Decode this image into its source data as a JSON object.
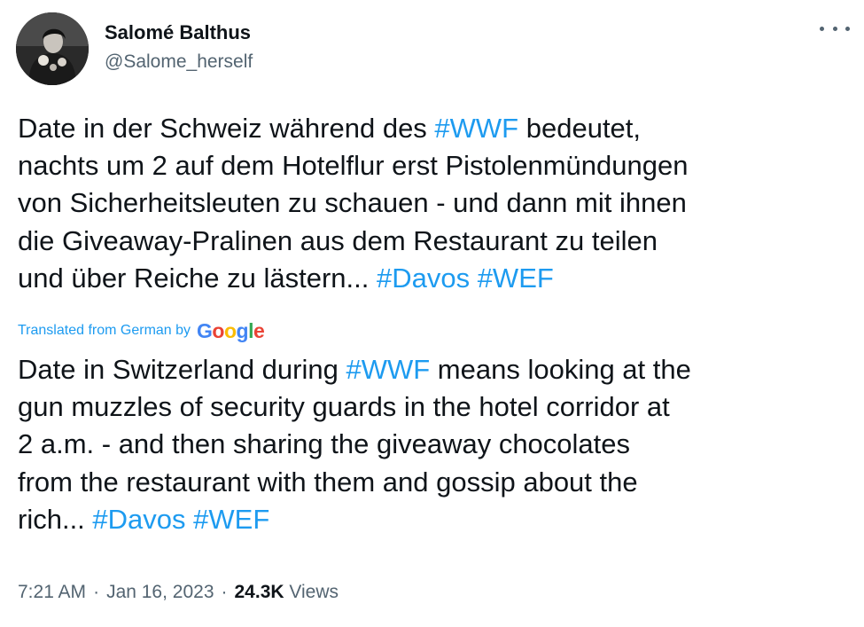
{
  "author": {
    "name": "Salomé Balthus",
    "handle": "@Salome_herself"
  },
  "tweet": {
    "original_lines": [
      [
        {
          "t": "Date in der Schweiz während des "
        },
        {
          "t": "#WWF",
          "tag": true
        },
        {
          "t": " bedeutet,"
        }
      ],
      [
        {
          "t": "nachts um 2 auf dem Hotelflur erst Pistolenmündungen"
        }
      ],
      [
        {
          "t": "von Sicherheitsleuten zu schauen - und dann mit ihnen"
        }
      ],
      [
        {
          "t": "die Giveaway-Pralinen aus dem Restaurant zu teilen"
        }
      ],
      [
        {
          "t": "und über Reiche zu lästern... "
        },
        {
          "t": "#Davos",
          "tag": true
        },
        {
          "t": " "
        },
        {
          "t": "#WEF",
          "tag": true
        }
      ]
    ],
    "translation_label": "Translated from German by",
    "translation_provider": "Google",
    "translated_lines": [
      [
        {
          "t": "Date in Switzerland during "
        },
        {
          "t": "#WWF",
          "tag": true
        },
        {
          "t": " means looking at the"
        }
      ],
      [
        {
          "t": "gun muzzles of security guards in the hotel corridor at"
        }
      ],
      [
        {
          "t": "2 a.m. - and then sharing the giveaway chocolates"
        }
      ],
      [
        {
          "t": "from the restaurant with them and gossip about the"
        }
      ],
      [
        {
          "t": "rich... "
        },
        {
          "t": "#Davos",
          "tag": true
        },
        {
          "t": " "
        },
        {
          "t": "#WEF",
          "tag": true
        }
      ]
    ]
  },
  "meta": {
    "time": "7:21 AM",
    "separator": "·",
    "date": "Jan 16, 2023",
    "views_count": "24.3K",
    "views_label": "Views"
  },
  "colors": {
    "text": "#0f1419",
    "secondary": "#536471",
    "link": "#1d9bf0"
  },
  "icons": {
    "more": "more-horizontal-icon",
    "avatar": "profile-photo"
  }
}
